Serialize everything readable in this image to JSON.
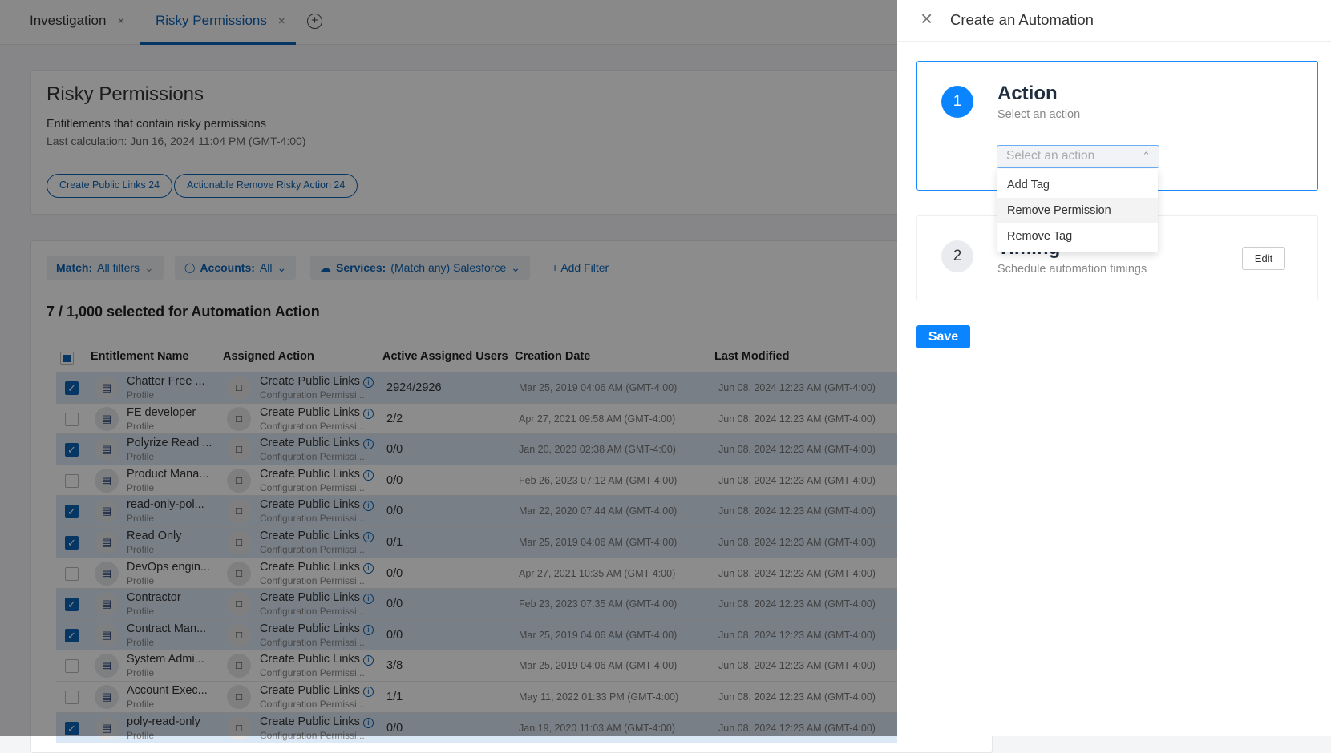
{
  "tabs": [
    {
      "label": "Investigation"
    },
    {
      "label": "Risky Permissions",
      "active": true
    }
  ],
  "icons": {
    "close": "×",
    "add_tab": "+",
    "check": "✓",
    "id_card": "▤",
    "doc": "🗋",
    "chevron_down": "⌄",
    "chevron_up": "⌃",
    "users": "👥",
    "cloud": "☁",
    "plus": "+"
  },
  "header": {
    "title": "Risky Permissions",
    "description": "Entitlements that contain risky permissions",
    "last_calc": "Last calculation: Jun 16, 2024 11:04 PM (GMT-4:00)",
    "pills": [
      "Create Public Links 24",
      "Actionable Remove Risky Action 24"
    ]
  },
  "filters": {
    "match_label": "Match:",
    "match_value": "All filters",
    "accounts_label": "Accounts:",
    "accounts_value": "All",
    "services_label": "Services:",
    "services_value": "(Match any) Salesforce",
    "add_filter": "Add Filter"
  },
  "selection": "7 / 1,000 selected for Automation Action",
  "columns": [
    "Entitlement Name",
    "Assigned Action",
    "Active Assigned Users",
    "Creation Date",
    "Last Modified"
  ],
  "rows": [
    {
      "sel": true,
      "name": "Chatter Free ...",
      "type": "Profile",
      "action": "Create Public Links",
      "action_sub": "Configuration Permissi...",
      "users": "2924/2926",
      "created": "Mar 25, 2019 04:06 AM (GMT-4:00)",
      "modified": "Jun 08, 2024 12:23 AM (GMT-4:00)"
    },
    {
      "sel": false,
      "name": "FE developer",
      "type": "Profile",
      "action": "Create Public Links",
      "action_sub": "Configuration Permissi...",
      "users": "2/2",
      "created": "Apr 27, 2021 09:58 AM (GMT-4:00)",
      "modified": "Jun 08, 2024 12:23 AM (GMT-4:00)"
    },
    {
      "sel": true,
      "name": "Polyrize Read ...",
      "type": "Profile",
      "action": "Create Public Links",
      "action_sub": "Configuration Permissi...",
      "users": "0/0",
      "created": "Jan 20, 2020 02:38 AM (GMT-4:00)",
      "modified": "Jun 08, 2024 12:23 AM (GMT-4:00)"
    },
    {
      "sel": false,
      "name": "Product Mana...",
      "type": "Profile",
      "action": "Create Public Links",
      "action_sub": "Configuration Permissi...",
      "users": "0/0",
      "created": "Feb 26, 2023 07:12 AM (GMT-4:00)",
      "modified": "Jun 08, 2024 12:23 AM (GMT-4:00)"
    },
    {
      "sel": true,
      "name": "read-only-pol...",
      "type": "Profile",
      "action": "Create Public Links",
      "action_sub": "Configuration Permissi...",
      "users": "0/0",
      "created": "Mar 22, 2020 07:44 AM (GMT-4:00)",
      "modified": "Jun 08, 2024 12:23 AM (GMT-4:00)"
    },
    {
      "sel": true,
      "name": "Read Only",
      "type": "Profile",
      "action": "Create Public Links",
      "action_sub": "Configuration Permissi...",
      "users": "0/1",
      "created": "Mar 25, 2019 04:06 AM (GMT-4:00)",
      "modified": "Jun 08, 2024 12:23 AM (GMT-4:00)"
    },
    {
      "sel": false,
      "name": "DevOps engin...",
      "type": "Profile",
      "action": "Create Public Links",
      "action_sub": "Configuration Permissi...",
      "users": "0/0",
      "created": "Apr 27, 2021 10:35 AM (GMT-4:00)",
      "modified": "Jun 08, 2024 12:23 AM (GMT-4:00)"
    },
    {
      "sel": true,
      "name": "Contractor",
      "type": "Profile",
      "action": "Create Public Links",
      "action_sub": "Configuration Permissi...",
      "users": "0/0",
      "created": "Feb 23, 2023 07:35 AM (GMT-4:00)",
      "modified": "Jun 08, 2024 12:23 AM (GMT-4:00)"
    },
    {
      "sel": true,
      "name": "Contract Man...",
      "type": "Profile",
      "action": "Create Public Links",
      "action_sub": "Configuration Permissi...",
      "users": "0/0",
      "created": "Mar 25, 2019 04:06 AM (GMT-4:00)",
      "modified": "Jun 08, 2024 12:23 AM (GMT-4:00)"
    },
    {
      "sel": false,
      "name": "System Admi...",
      "type": "Profile",
      "action": "Create Public Links",
      "action_sub": "Configuration Permissi...",
      "users": "3/8",
      "created": "Mar 25, 2019 04:06 AM (GMT-4:00)",
      "modified": "Jun 08, 2024 12:23 AM (GMT-4:00)"
    },
    {
      "sel": false,
      "name": "Account Exec...",
      "type": "Profile",
      "action": "Create Public Links",
      "action_sub": "Configuration Permissi...",
      "users": "1/1",
      "created": "May 11, 2022 01:33 PM (GMT-4:00)",
      "modified": "Jun 08, 2024 12:23 AM (GMT-4:00)"
    },
    {
      "sel": true,
      "name": "poly-read-only",
      "type": "Profile",
      "action": "Create Public Links",
      "action_sub": "Configuration Permissi...",
      "users": "0/0",
      "created": "Jan 19, 2020 11:03 AM (GMT-4:00)",
      "modified": "Jun 08, 2024 12:23 AM (GMT-4:00)"
    }
  ],
  "panel": {
    "title": "Create an Automation",
    "step1": {
      "number": "1",
      "title": "Action",
      "subtitle": "Select an action",
      "placeholder": "Select an action",
      "options": [
        "Add Tag",
        "Remove Permission",
        "Remove Tag"
      ],
      "highlighted": "Remove Permission"
    },
    "step2": {
      "number": "2",
      "title": "Timing",
      "subtitle": "Schedule automation timings",
      "edit": "Edit"
    },
    "save": "Save"
  },
  "colors": {
    "accent": "#0b63b6",
    "primary_button": "#0a84ff"
  }
}
